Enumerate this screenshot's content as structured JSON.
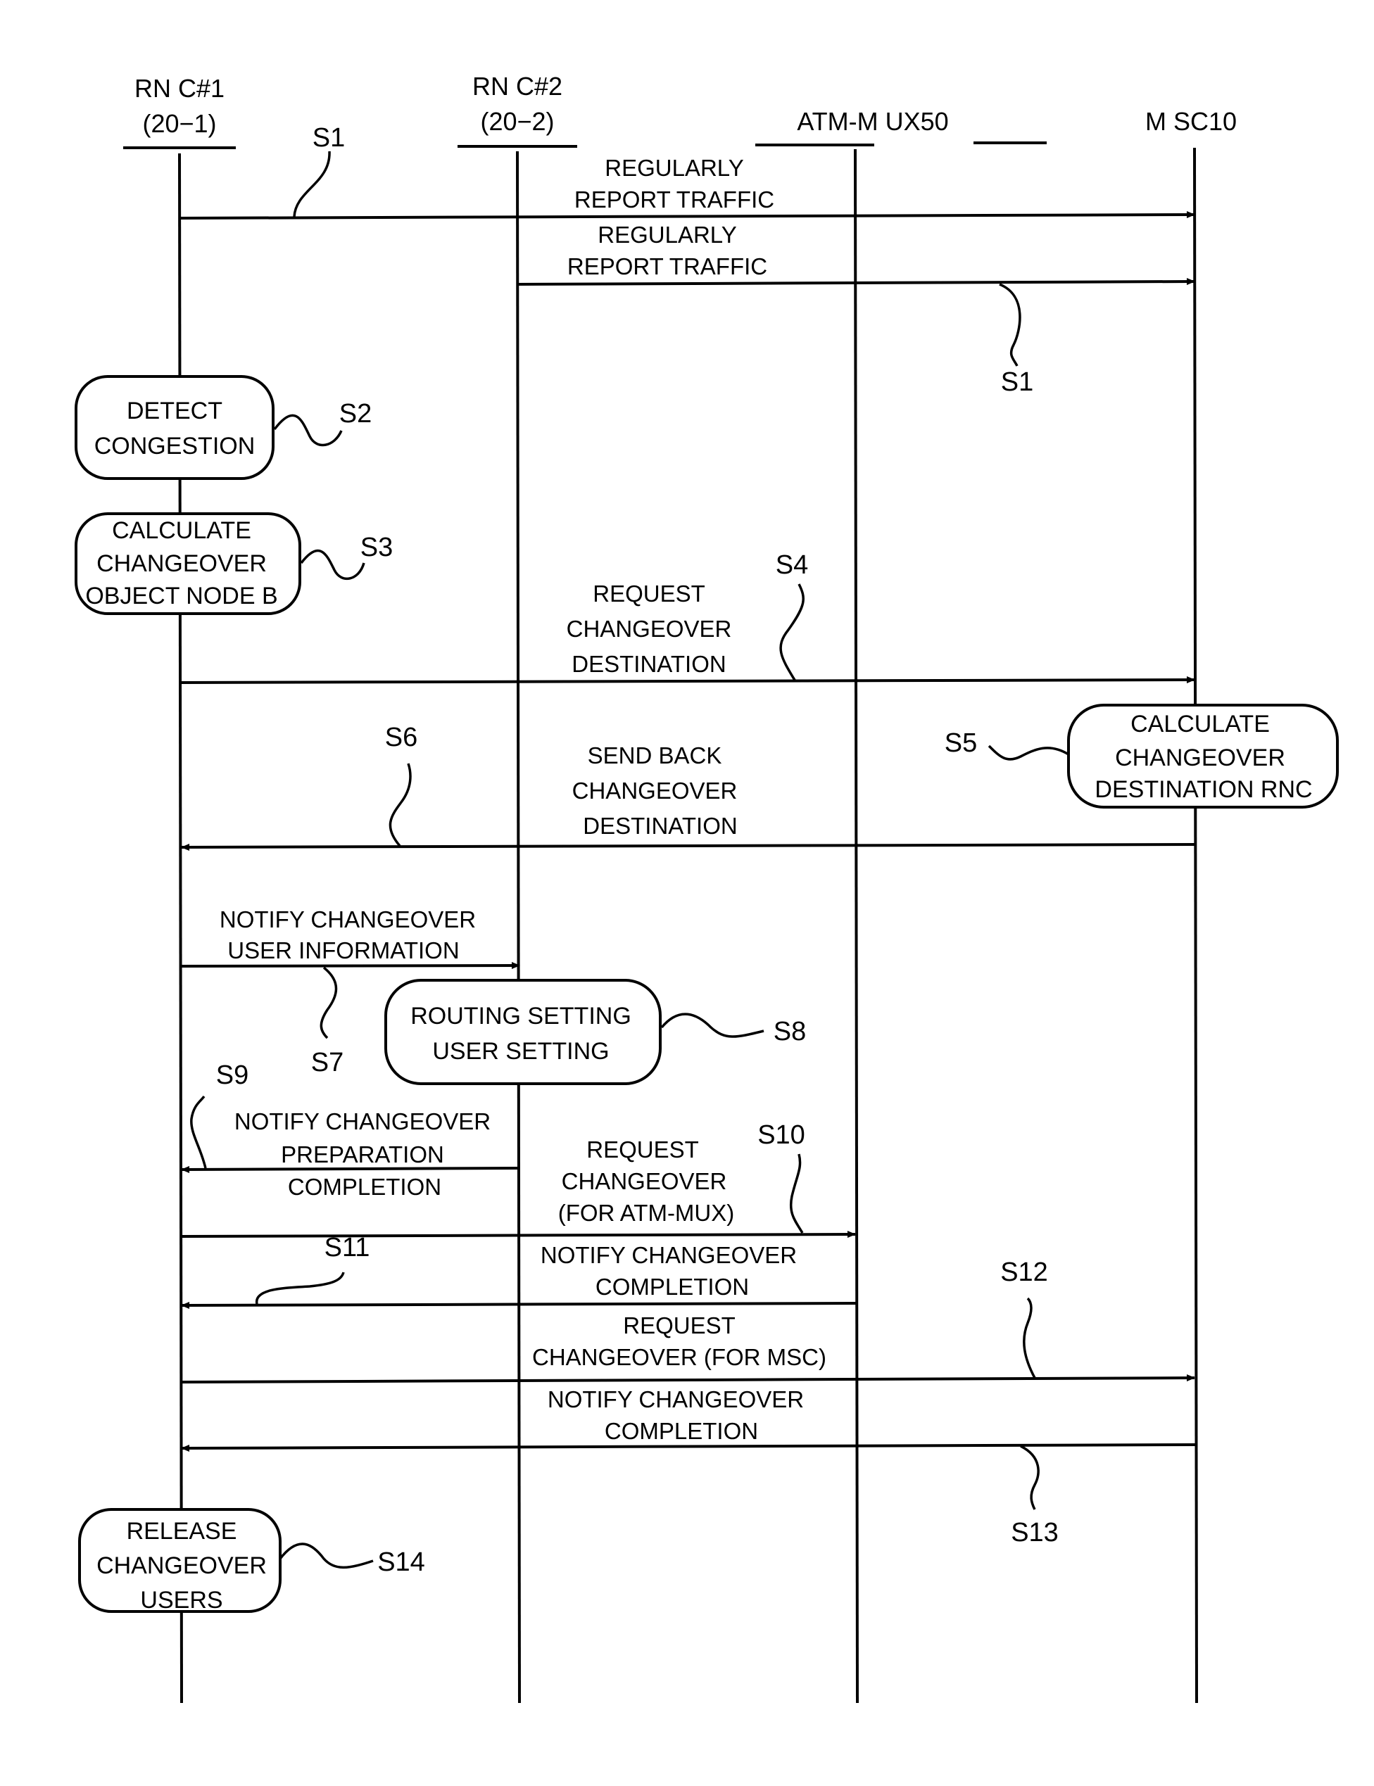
{
  "diagram": {
    "type": "sequence",
    "participants": [
      {
        "id": "rnc1",
        "name": "RN C#1",
        "sub": "(20−1)"
      },
      {
        "id": "rnc2",
        "name": "RN C#2",
        "sub": "(20−2)"
      },
      {
        "id": "atm",
        "name": "ATM-M UX50",
        "sub": ""
      },
      {
        "id": "msc",
        "name": "M SC10",
        "sub": ""
      }
    ],
    "messages": [
      {
        "step": "S1",
        "from": "rnc1",
        "to": "msc",
        "lines": [
          "REGULARLY",
          "REPORT TRAFFIC"
        ]
      },
      {
        "step": "S1",
        "from": "rnc2",
        "to": "msc",
        "lines": [
          "REGULARLY",
          "REPORT TRAFFIC"
        ]
      },
      {
        "step": "S4",
        "from": "rnc1",
        "to": "msc",
        "lines": [
          "REQUEST",
          "CHANGEOVER",
          "DESTINATION"
        ]
      },
      {
        "step": "S6",
        "from": "msc",
        "to": "rnc1",
        "lines": [
          "SEND BACK",
          "CHANGEOVER",
          "DESTINATION"
        ]
      },
      {
        "step": "S7",
        "from": "rnc1",
        "to": "rnc2",
        "lines": [
          "NOTIFY CHANGEOVER",
          "USER INFORMATION"
        ]
      },
      {
        "step": "S9",
        "from": "rnc2",
        "to": "rnc1",
        "lines": [
          "NOTIFY CHANGEOVER",
          "PREPARATION",
          "COMPLETION"
        ]
      },
      {
        "step": "S10",
        "from": "rnc1",
        "to": "atm",
        "lines": [
          "REQUEST",
          "CHANGEOVER",
          "(FOR ATM-MUX)"
        ]
      },
      {
        "step": "S11",
        "from": "atm",
        "to": "rnc1",
        "lines": [
          "NOTIFY CHANGEOVER",
          "COMPLETION"
        ]
      },
      {
        "step": "S12",
        "from": "rnc1",
        "to": "msc",
        "lines": [
          "REQUEST",
          "CHANGEOVER (FOR MSC)"
        ]
      },
      {
        "step": "S13",
        "from": "msc",
        "to": "rnc1",
        "lines": [
          "NOTIFY CHANGEOVER",
          "COMPLETION"
        ]
      }
    ],
    "processes": [
      {
        "step": "S2",
        "on": "rnc1",
        "lines": [
          "DETECT",
          "CONGESTION"
        ]
      },
      {
        "step": "S3",
        "on": "rnc1",
        "lines": [
          "CALCULATE",
          "CHANGEOVER",
          "OBJECT NODE B"
        ]
      },
      {
        "step": "S5",
        "on": "msc",
        "lines": [
          "CALCULATE",
          "CHANGEOVER",
          "DESTINATION RNC"
        ]
      },
      {
        "step": "S8",
        "on": "rnc2",
        "lines": [
          "ROUTING SETTING",
          "USER SETTING"
        ]
      },
      {
        "step": "S14",
        "on": "rnc1",
        "lines": [
          "RELEASE",
          "CHANGEOVER",
          "USERS"
        ]
      }
    ]
  }
}
